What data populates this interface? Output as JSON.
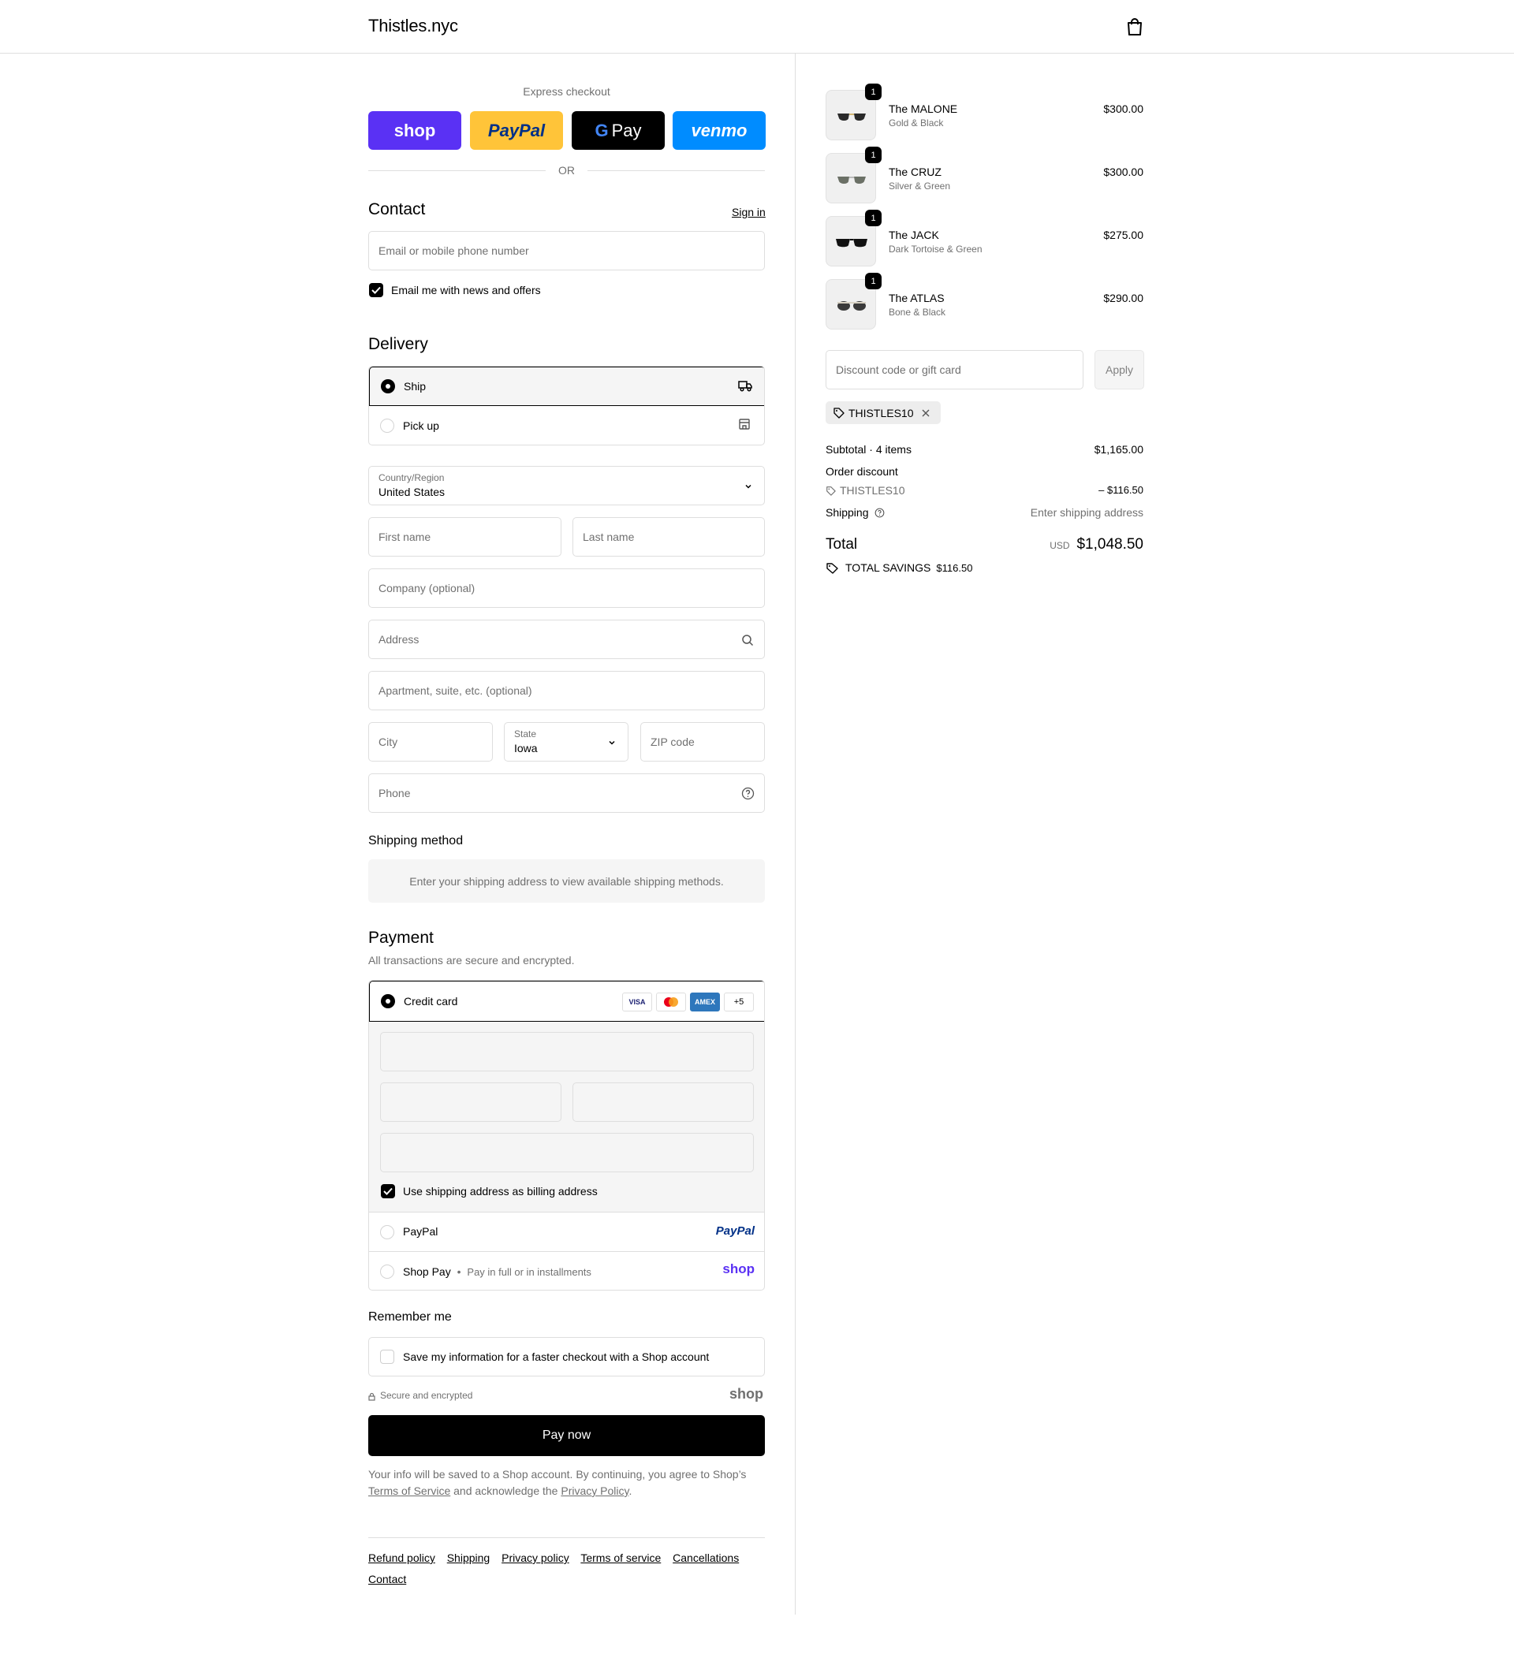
{
  "header": {
    "brand": "Thistles.nyc",
    "cart_icon": "shopping-bag-icon"
  },
  "express": {
    "label": "Express checkout",
    "buttons": [
      {
        "name": "shop",
        "label": "shop",
        "bg": "#5a31f4",
        "fg": "#ffffff"
      },
      {
        "name": "paypal",
        "label": "PayPal",
        "bg": "#ffc439",
        "fg": "#003087"
      },
      {
        "name": "gpay",
        "label": "Pay",
        "bg": "#000000",
        "fg": "#ffffff"
      },
      {
        "name": "venmo",
        "label": "venmo",
        "bg": "#008cff",
        "fg": "#ffffff"
      }
    ],
    "or": "OR"
  },
  "contact": {
    "title": "Contact",
    "sign_in": "Sign in",
    "email_placeholder": "Email or mobile phone number",
    "news_label": "Email me with news and offers"
  },
  "delivery": {
    "title": "Delivery",
    "ship": "Ship",
    "pickup": "Pick up",
    "country_label": "Country/Region",
    "country_value": "United States",
    "first_name": "First name",
    "last_name": "Last name",
    "company": "Company (optional)",
    "address": "Address",
    "apartment": "Apartment, suite, etc. (optional)",
    "city": "City",
    "state_label": "State",
    "state_value": "Iowa",
    "zip": "ZIP code",
    "phone": "Phone"
  },
  "shipping_method": {
    "title": "Shipping method",
    "message": "Enter your shipping address to view available shipping methods."
  },
  "payment": {
    "title": "Payment",
    "subtitle": "All transactions are secure and encrypted.",
    "credit_card": "Credit card",
    "card_brands": [
      "VISA",
      "",
      "AMEX",
      "+5"
    ],
    "billing_label": "Use shipping address as billing address",
    "paypal": "PayPal",
    "paypal_logo": "PayPal",
    "shop_pay": "Shop Pay",
    "shop_pay_sub": "Pay in full or in installments",
    "shop_logo": "shop"
  },
  "remember": {
    "title": "Remember me",
    "save_label": "Save my information for a faster checkout with a Shop account",
    "secure": "Secure and encrypted",
    "shop_logo": "shop"
  },
  "pay_now": "Pay now",
  "legal": {
    "text1": "Your info will be saved to a Shop account. By continuing, you agree to Shop’s",
    "tos": "Terms of Service",
    "text2": "and acknowledge the",
    "privacy": "Privacy Policy",
    "end": "."
  },
  "footer": {
    "links": [
      "Refund policy",
      "Shipping",
      "Privacy policy",
      "Terms of service",
      "Cancellations",
      "Contact"
    ]
  },
  "order": {
    "items": [
      {
        "name": "The MALONE",
        "variant": "Gold & Black",
        "price": "$300.00",
        "qty": "1"
      },
      {
        "name": "The CRUZ",
        "variant": "Silver & Green",
        "price": "$300.00",
        "qty": "1"
      },
      {
        "name": "The JACK",
        "variant": "Dark Tortoise & Green",
        "price": "$275.00",
        "qty": "1"
      },
      {
        "name": "The ATLAS",
        "variant": "Bone & Black",
        "price": "$290.00",
        "qty": "1"
      }
    ],
    "discount_placeholder": "Discount code or gift card",
    "apply": "Apply",
    "applied_code": "THISTLES10",
    "subtotal_label": "Subtotal · 4 items",
    "subtotal_value": "$1,165.00",
    "order_discount_label": "Order discount",
    "discount_code": "THISTLES10",
    "discount_value": "– $116.50",
    "shipping_label": "Shipping",
    "shipping_value": "Enter shipping address",
    "total_label": "Total",
    "currency": "USD",
    "total_value": "$1,048.50",
    "savings_label": "TOTAL SAVINGS",
    "savings_value": "$116.50"
  }
}
